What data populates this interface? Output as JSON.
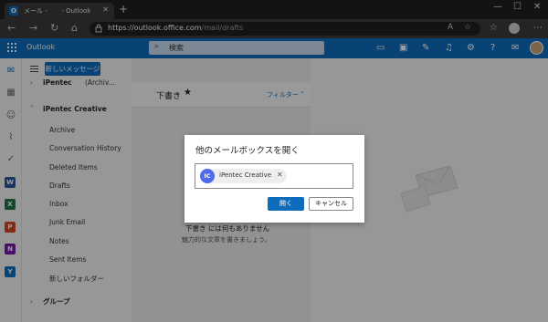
{
  "browser": {
    "tab_title": "メール -       - Outlook",
    "tab_close": "✕",
    "new_tab": "+",
    "window_controls": [
      "—",
      "☐",
      "✕"
    ],
    "nav": [
      "←",
      "→",
      "↻",
      "⌂"
    ],
    "url_host": "https://outlook.office.com",
    "url_path": "/mail/drafts"
  },
  "header": {
    "brand": "Outlook",
    "search_placeholder": "検索"
  },
  "rail": {
    "icons": [
      "mail-icon",
      "calendar-icon",
      "people-icon",
      "attach-icon",
      "todo-icon",
      "word-icon",
      "excel-icon",
      "powerpoint-icon",
      "onenote-icon",
      "yammer-icon"
    ],
    "badges": {
      "word": "W",
      "excel": "X",
      "powerpoint": "P",
      "onenote": "N",
      "yammer": "Y"
    }
  },
  "folders": {
    "new_message": "新しいメッセージ",
    "account1": "iPentec",
    "account1_tail": "(Archiv...",
    "account2": "iPentec Creative",
    "items": [
      "Archive",
      "Conversation History",
      "Deleted Items",
      "Drafts",
      "Inbox",
      "Junk Email",
      "Notes",
      "Sent Items",
      "新しいフォルダー"
    ],
    "group": "グループ"
  },
  "list": {
    "title": "下書き",
    "filter": "フィルター",
    "empty_main": "下書き には何もありません",
    "empty_sub": "魅力的な文章を書きましょう。"
  },
  "dialog": {
    "title": "他のメールボックスを開く",
    "chip_initials": "IC",
    "chip_name": "iPentec Creative",
    "open": "開く",
    "cancel": "キャンセル"
  },
  "colors": {
    "brand": "#0f6cbd",
    "chip_avatar": "#4f6bed"
  }
}
